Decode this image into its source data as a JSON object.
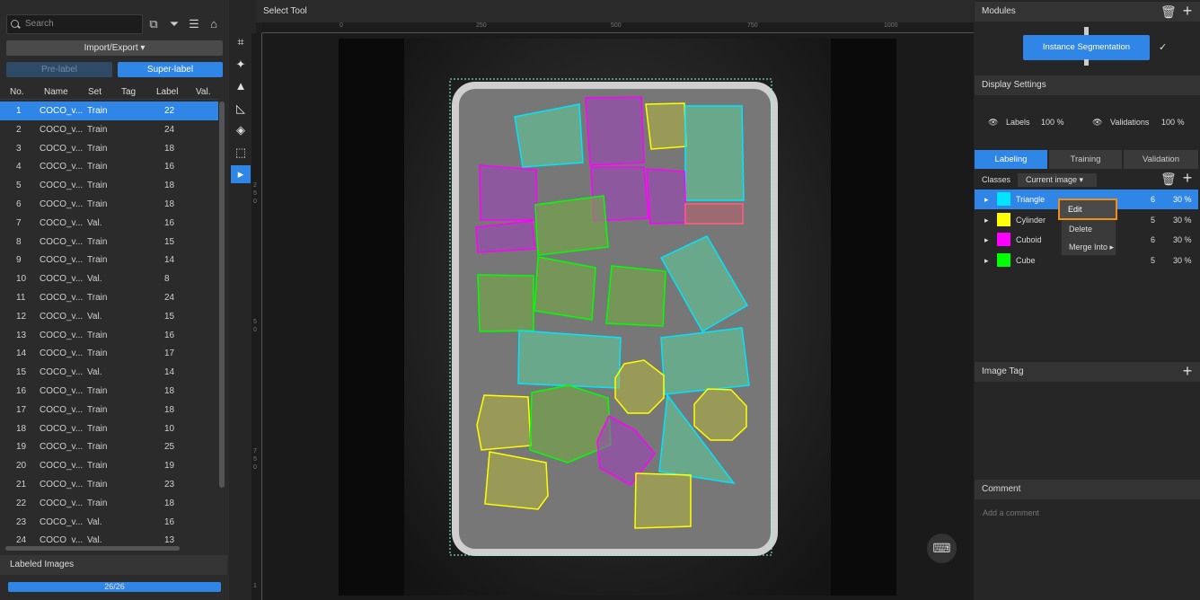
{
  "left_panel": {
    "search_placeholder": "Search",
    "import_export_label": "Import/Export ▾",
    "pre_label": "Pre-label",
    "super_label": "Super-label",
    "columns": [
      "No.",
      "Name",
      "Set",
      "Tag",
      "Label",
      "Val."
    ],
    "rows": [
      {
        "no": "1",
        "name": "COCO_v...",
        "set": "Train",
        "label": "22",
        "selected": true
      },
      {
        "no": "2",
        "name": "COCO_v...",
        "set": "Train",
        "label": "24"
      },
      {
        "no": "3",
        "name": "COCO_v...",
        "set": "Train",
        "label": "18"
      },
      {
        "no": "4",
        "name": "COCO_v...",
        "set": "Train",
        "label": "16"
      },
      {
        "no": "5",
        "name": "COCO_v...",
        "set": "Train",
        "label": "18"
      },
      {
        "no": "6",
        "name": "COCO_v...",
        "set": "Train",
        "label": "18"
      },
      {
        "no": "7",
        "name": "COCO_v...",
        "set": "Val.",
        "label": "16"
      },
      {
        "no": "8",
        "name": "COCO_v...",
        "set": "Train",
        "label": "15"
      },
      {
        "no": "9",
        "name": "COCO_v...",
        "set": "Train",
        "label": "14"
      },
      {
        "no": "10",
        "name": "COCO_v...",
        "set": "Val.",
        "label": "8"
      },
      {
        "no": "11",
        "name": "COCO_v...",
        "set": "Train",
        "label": "24"
      },
      {
        "no": "12",
        "name": "COCO_v...",
        "set": "Val.",
        "label": "15"
      },
      {
        "no": "13",
        "name": "COCO_v...",
        "set": "Train",
        "label": "16"
      },
      {
        "no": "14",
        "name": "COCO_v...",
        "set": "Train",
        "label": "17"
      },
      {
        "no": "15",
        "name": "COCO_v...",
        "set": "Val.",
        "label": "14"
      },
      {
        "no": "16",
        "name": "COCO_v...",
        "set": "Train",
        "label": "18"
      },
      {
        "no": "17",
        "name": "COCO_v...",
        "set": "Train",
        "label": "18"
      },
      {
        "no": "18",
        "name": "COCO_v...",
        "set": "Train",
        "label": "10"
      },
      {
        "no": "19",
        "name": "COCO_v...",
        "set": "Train",
        "label": "25"
      },
      {
        "no": "20",
        "name": "COCO_v...",
        "set": "Train",
        "label": "19"
      },
      {
        "no": "21",
        "name": "COCO_v...",
        "set": "Train",
        "label": "23"
      },
      {
        "no": "22",
        "name": "COCO_v...",
        "set": "Train",
        "label": "18"
      },
      {
        "no": "23",
        "name": "COCO_v...",
        "set": "Val.",
        "label": "16"
      },
      {
        "no": "24",
        "name": "COCO_v...",
        "set": "Val.",
        "label": "13"
      }
    ],
    "labeled_images_title": "Labeled Images",
    "progress_text": "26/26",
    "progress_fraction": 1.0
  },
  "toolbar": {
    "tools": [
      {
        "name": "polygon-tool-icon",
        "glyph": "⌗"
      },
      {
        "name": "magic-wand-tool-icon",
        "glyph": "✦"
      },
      {
        "name": "stamp-tool-icon",
        "glyph": "▲"
      },
      {
        "name": "smart-polygon-tool-icon",
        "glyph": "◺"
      },
      {
        "name": "eraser-tool-icon",
        "glyph": "◈"
      },
      {
        "name": "rect-select-tool-icon",
        "glyph": "⬚"
      },
      {
        "name": "select-tool-icon",
        "glyph": "▸",
        "active": true
      }
    ]
  },
  "canvas": {
    "title": "Select Tool",
    "ruler_h": [
      "0",
      "250",
      "500",
      "750",
      "1000"
    ],
    "ruler_v": [
      "2",
      "5",
      "0",
      "5",
      "0",
      "7",
      "5",
      "0",
      "1"
    ]
  },
  "right_panel": {
    "modules_title": "Modules",
    "module_button": "Instance Segmentation",
    "display_settings_title": "Display Settings",
    "labels_text": "Labels",
    "labels_pct": "100 %",
    "validations_text": "Validations",
    "validations_pct": "100 %",
    "tabs": [
      "Labeling",
      "Training",
      "Validation"
    ],
    "classes_label": "Classes",
    "classes_filter": "Current image ▾",
    "classes": [
      {
        "name": "Triangle",
        "color": "#00e5ff",
        "count": "6",
        "pct": "30 %",
        "selected": true
      },
      {
        "name": "Cylinder",
        "color": "#ffff00",
        "count": "5",
        "pct": "30 %"
      },
      {
        "name": "Cuboid",
        "color": "#ff00ff",
        "count": "6",
        "pct": "30 %"
      },
      {
        "name": "Cube",
        "color": "#00ff00",
        "count": "5",
        "pct": "30 %"
      }
    ],
    "context_menu": [
      "Edit",
      "Delete",
      "Merge Into ▸"
    ],
    "image_tag_title": "Image Tag",
    "comment_title": "Comment",
    "comment_placeholder": "Add a comment"
  }
}
